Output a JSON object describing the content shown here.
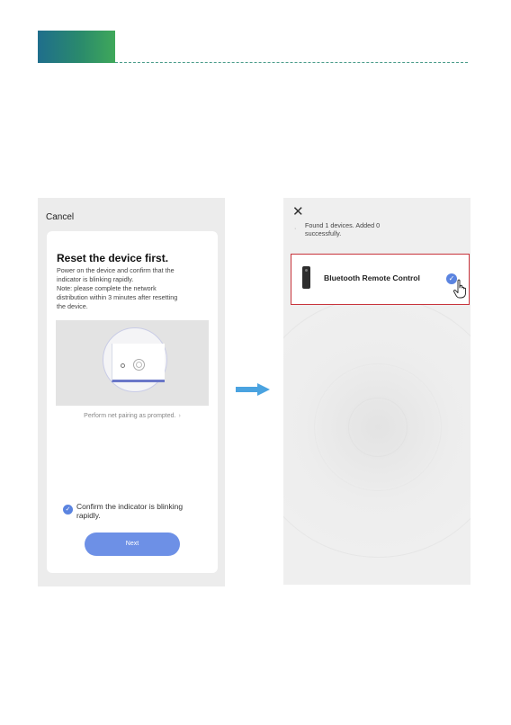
{
  "left_screen": {
    "cancel_label": "Cancel",
    "title": "Reset the device first.",
    "instructions": [
      "Power on the device and confirm that the",
      "indicator is blinking rapidly.",
      "Note: please complete the network",
      "distribution within 3 minutes after resetting",
      "the device."
    ],
    "pairing_link": "Perform net pairing as prompted.",
    "pairing_icon": "chevron-right-icon",
    "confirm_lines": [
      "Confirm the indicator is blinking",
      "rapidly."
    ],
    "confirm_checked": true,
    "next_label": "Next"
  },
  "arrow_icon": "arrow-right-icon",
  "right_screen": {
    "close_icon": "close-icon",
    "found_lines": [
      "Found 1 devices. Added 0",
      "successfully."
    ],
    "device": {
      "name": "Bluetooth Remote Control",
      "icon": "remote-control-icon",
      "selected": true
    },
    "cursor_icon": "hand-pointer-icon"
  },
  "colors": {
    "accent": "#6d90e6",
    "check": "#5b84e0",
    "highlight_border": "#c8343c",
    "arrow": "#4aa3e0",
    "header_gradient_start": "#1f6e8c",
    "header_gradient_end": "#3fa85a"
  }
}
